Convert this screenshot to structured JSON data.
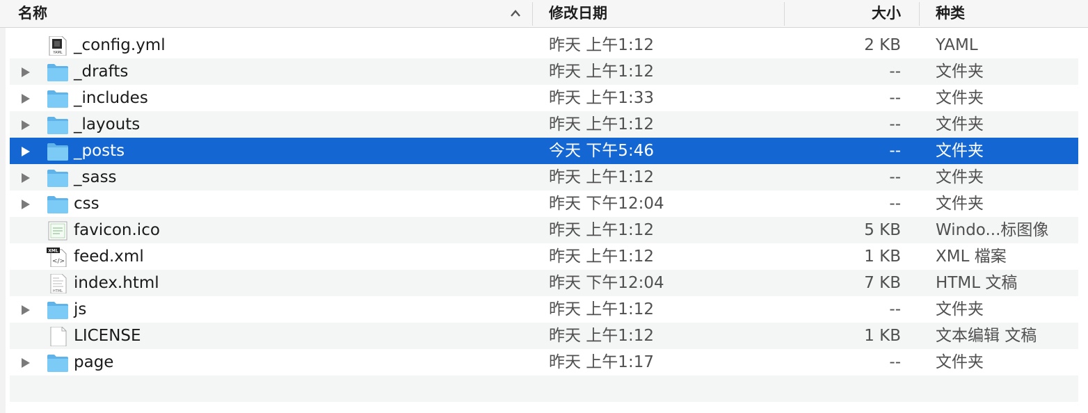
{
  "columns": {
    "name": "名称",
    "date": "修改日期",
    "size": "大小",
    "kind": "种类"
  },
  "rows": [
    {
      "name": "_config.yml",
      "date": "昨天 上午1:12",
      "size": "2 KB",
      "kind": "YAML",
      "icon": "yaml-file-icon",
      "folder": false
    },
    {
      "name": "_drafts",
      "date": "昨天 上午1:12",
      "size": "--",
      "kind": "文件夹",
      "icon": "folder-icon",
      "folder": true
    },
    {
      "name": "_includes",
      "date": "昨天 上午1:33",
      "size": "--",
      "kind": "文件夹",
      "icon": "folder-icon",
      "folder": true
    },
    {
      "name": "_layouts",
      "date": "昨天 上午1:12",
      "size": "--",
      "kind": "文件夹",
      "icon": "folder-icon",
      "folder": true
    },
    {
      "name": "_posts",
      "date": "今天 下午5:46",
      "size": "--",
      "kind": "文件夹",
      "icon": "folder-icon",
      "folder": true,
      "selected": true
    },
    {
      "name": "_sass",
      "date": "昨天 上午1:12",
      "size": "--",
      "kind": "文件夹",
      "icon": "folder-icon",
      "folder": true
    },
    {
      "name": "css",
      "date": "昨天 下午12:04",
      "size": "--",
      "kind": "文件夹",
      "icon": "folder-icon",
      "folder": true
    },
    {
      "name": "favicon.ico",
      "date": "昨天 上午1:12",
      "size": "5 KB",
      "kind": "Windo...标图像",
      "icon": "ico-file-icon",
      "folder": false
    },
    {
      "name": "feed.xml",
      "date": "昨天 上午1:12",
      "size": "1 KB",
      "kind": "XML 檔案",
      "icon": "xml-file-icon",
      "folder": false
    },
    {
      "name": "index.html",
      "date": "昨天 下午12:04",
      "size": "7 KB",
      "kind": "HTML 文稿",
      "icon": "html-file-icon",
      "folder": false
    },
    {
      "name": "js",
      "date": "昨天 上午1:12",
      "size": "--",
      "kind": "文件夹",
      "icon": "folder-icon",
      "folder": true
    },
    {
      "name": "LICENSE",
      "date": "昨天 上午1:12",
      "size": "1 KB",
      "kind": "文本编辑 文稿",
      "icon": "text-file-icon",
      "folder": false
    },
    {
      "name": "page",
      "date": "昨天 上午1:17",
      "size": "--",
      "kind": "文件夹",
      "icon": "folder-icon",
      "folder": true
    }
  ],
  "colors": {
    "selection": "#1467d2",
    "folder": "#6cc3f4",
    "stripe": "#f4f5f5"
  }
}
